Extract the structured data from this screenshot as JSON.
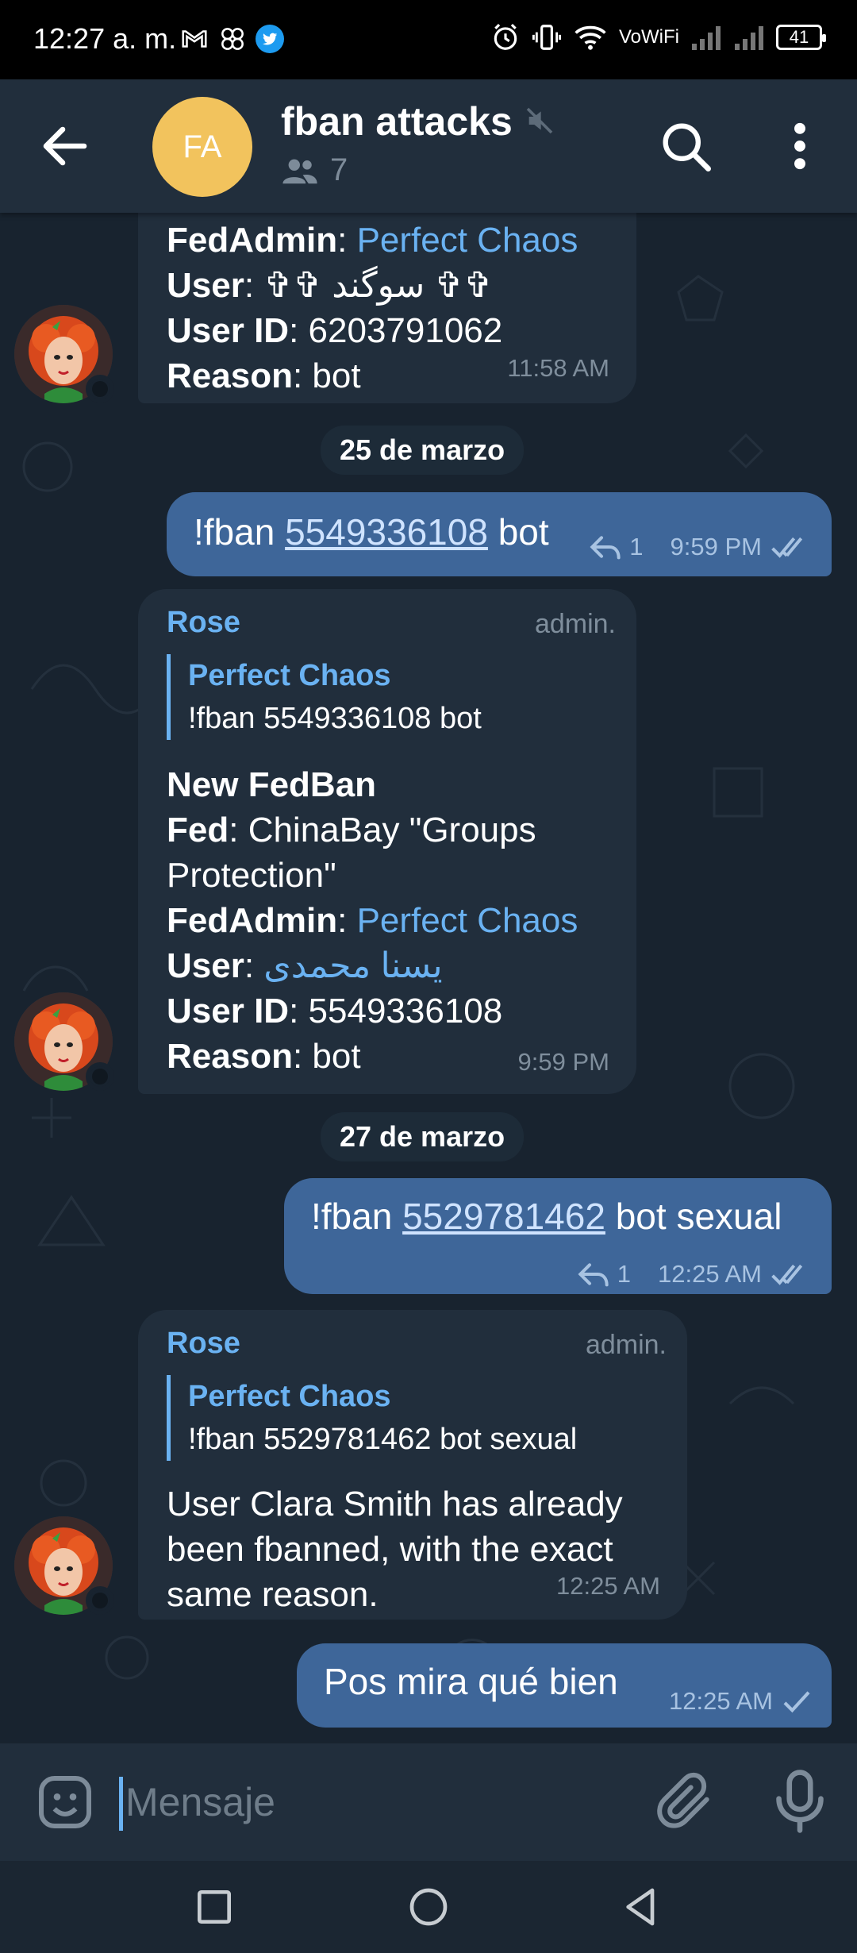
{
  "status_bar": {
    "time": "12:27 a. m.",
    "network_label": "VoWiFi",
    "battery": "41"
  },
  "header": {
    "avatar_initials": "FA",
    "title": "fban attacks",
    "member_count": "7"
  },
  "messages": [
    {
      "type": "incoming-partial",
      "lines": [
        {
          "label": "FedAdmin",
          "value": "Perfect Chaos"
        },
        {
          "label": "User",
          "value": "✞✞ سوگند ✞✞"
        },
        {
          "label": "User ID",
          "value": "6203791062"
        },
        {
          "label": "Reason",
          "value": "bot"
        }
      ],
      "time": "11:58 AM"
    },
    {
      "type": "date",
      "text": "25 de marzo"
    },
    {
      "type": "outgoing",
      "prefix": "!fban ",
      "link": "5549336108",
      "suffix": " bot",
      "replies": "1",
      "time": "9:59 PM"
    },
    {
      "type": "incoming",
      "sender": "Rose",
      "tag": "admin.",
      "quote_name": "Perfect Chaos",
      "quote_text": "!fban 5549336108 bot",
      "heading": "New FedBan",
      "fed_label": "Fed",
      "fed_value": "ChinaBay \"Groups Protection\"",
      "fedadmin_label": "FedAdmin",
      "fedadmin_value": "Perfect Chaos",
      "user_label": "User",
      "user_value": "یسنا محمدی",
      "userid_label": "User ID",
      "userid_value": "5549336108",
      "reason_label": "Reason",
      "reason_value": "bot",
      "time": "9:59 PM"
    },
    {
      "type": "date",
      "text": "27 de marzo"
    },
    {
      "type": "outgoing",
      "prefix": "!fban ",
      "link": "5529781462",
      "suffix": " bot sexual",
      "replies": "1",
      "time": "12:25 AM"
    },
    {
      "type": "incoming",
      "sender": "Rose",
      "tag": "admin.",
      "quote_name": "Perfect Chaos",
      "quote_text": "!fban 5529781462 bot sexual",
      "body": "User Clara Smith has already been fbanned, with the exact same reason.",
      "time": "12:25 AM"
    },
    {
      "type": "outgoing",
      "text": "Pos mira qué bien",
      "time": "12:25 AM"
    }
  ],
  "input": {
    "placeholder": "Mensaje"
  },
  "colors": {
    "header_bg": "#212e3c",
    "chat_bg": "#18232f",
    "incoming_bubble": "#212e3c",
    "outgoing_bubble": "#3e6699",
    "link": "#6ab2f2",
    "avatar_fa": "#f2c35d"
  },
  "icons": [
    "gmail-icon",
    "pinwheel-icon",
    "twitter-icon",
    "alarm-icon",
    "vibrate-icon",
    "wifi-icon",
    "signal-icon",
    "battery-icon",
    "back-arrow-icon",
    "mute-icon",
    "members-icon",
    "search-icon",
    "more-vert-icon",
    "reply-icon",
    "double-check-icon",
    "single-check-icon",
    "emoji-icon",
    "attach-icon",
    "mic-icon",
    "nav-recents-icon",
    "nav-home-icon",
    "nav-back-icon"
  ]
}
